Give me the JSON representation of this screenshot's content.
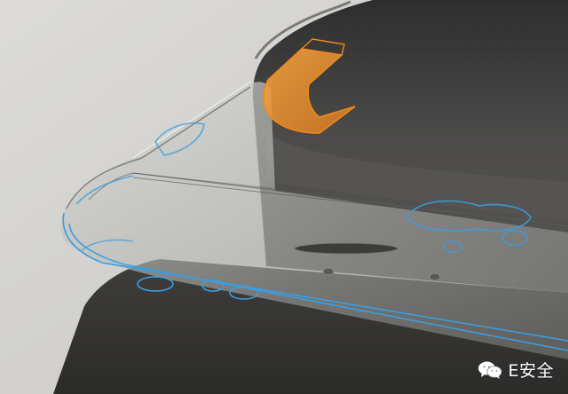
{
  "image": {
    "subject": "phone-antenna-render",
    "colors": {
      "background": "#d9d8d5",
      "shadow": "#3c3b39",
      "phone_body": "#474645",
      "glass_shell": "#c9c9c6",
      "wireframe_blue": "#3a9fe0",
      "antenna_orange": "#f08a1c"
    }
  },
  "watermark": {
    "text": "E安全",
    "icon": "wechat-icon"
  }
}
